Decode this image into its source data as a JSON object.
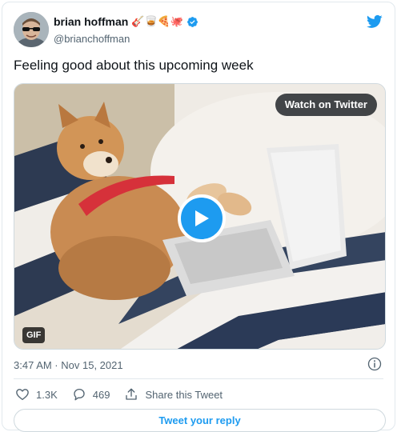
{
  "author": {
    "display_name": "brian hoffman",
    "emojis": "🎸🥃🍕🐙",
    "handle": "@brianchoffman"
  },
  "tweet": {
    "text": "Feeling good about this upcoming week",
    "timestamp": "3:47 AM · Nov 15, 2021"
  },
  "media": {
    "watch_label": "Watch on Twitter",
    "gif_badge": "GIF"
  },
  "actions": {
    "likes": "1.3K",
    "replies": "469",
    "share_label": "Share this Tweet"
  },
  "reply_button": "Tweet your reply",
  "colors": {
    "brand": "#1d9bf0",
    "text_primary": "#0f1419",
    "text_secondary": "#536471",
    "border": "#e1e8ed"
  },
  "icons": [
    "twitter-bird-icon",
    "verified-badge-icon",
    "play-icon",
    "info-icon",
    "heart-icon",
    "reply-icon",
    "share-icon"
  ]
}
